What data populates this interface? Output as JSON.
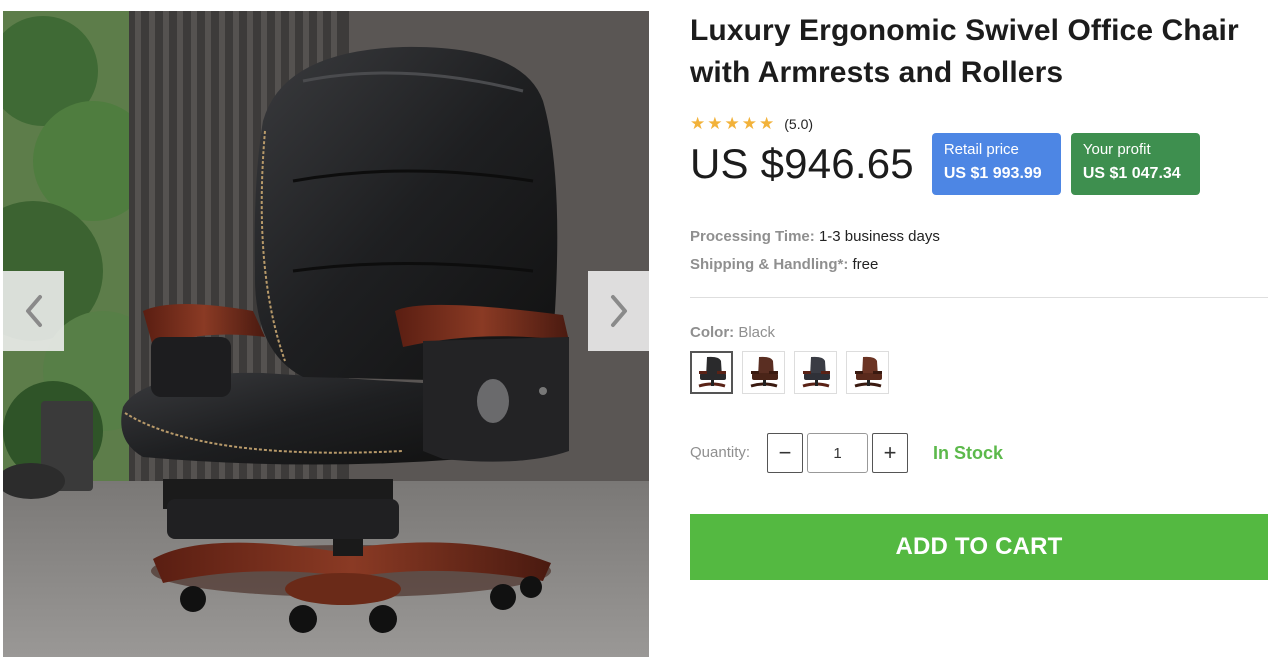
{
  "product": {
    "title": "Luxury Ergonomic Swivel Office Chair with Armrests and Rollers",
    "rating": {
      "stars": 5,
      "value_text": "(5.0)"
    },
    "price": "US $946.65",
    "retail": {
      "label": "Retail price",
      "value": "US $1 993.99"
    },
    "profit": {
      "label": "Your profit",
      "value": "US $1 047.34"
    },
    "processing": {
      "label": "Processing Time:",
      "value": "1-3 business days"
    },
    "shipping": {
      "label": "Shipping & Handling*:",
      "value": "free"
    },
    "color": {
      "label": "Color:",
      "value": "Black"
    },
    "swatches": [
      {
        "name": "Black",
        "selected": true,
        "color": "#2a2a2c"
      },
      {
        "name": "Brown",
        "selected": false,
        "color": "#5a2e22"
      },
      {
        "name": "Black variant",
        "selected": false,
        "color": "#3a3c44"
      },
      {
        "name": "Brown variant",
        "selected": false,
        "color": "#6b3424"
      }
    ],
    "quantity": {
      "label": "Quantity:",
      "value": "1",
      "minus": "−",
      "plus": "+"
    },
    "stock": "In Stock",
    "cart_button": "ADD TO CART"
  },
  "gallery": {
    "prev_icon": "chevron-left-icon",
    "next_icon": "chevron-right-icon"
  },
  "colors": {
    "retail_badge": "#4d86e4",
    "profit_badge": "#3e8f4f",
    "cart_button": "#54b941",
    "in_stock": "#5cb94b",
    "star": "#f2b23a"
  }
}
